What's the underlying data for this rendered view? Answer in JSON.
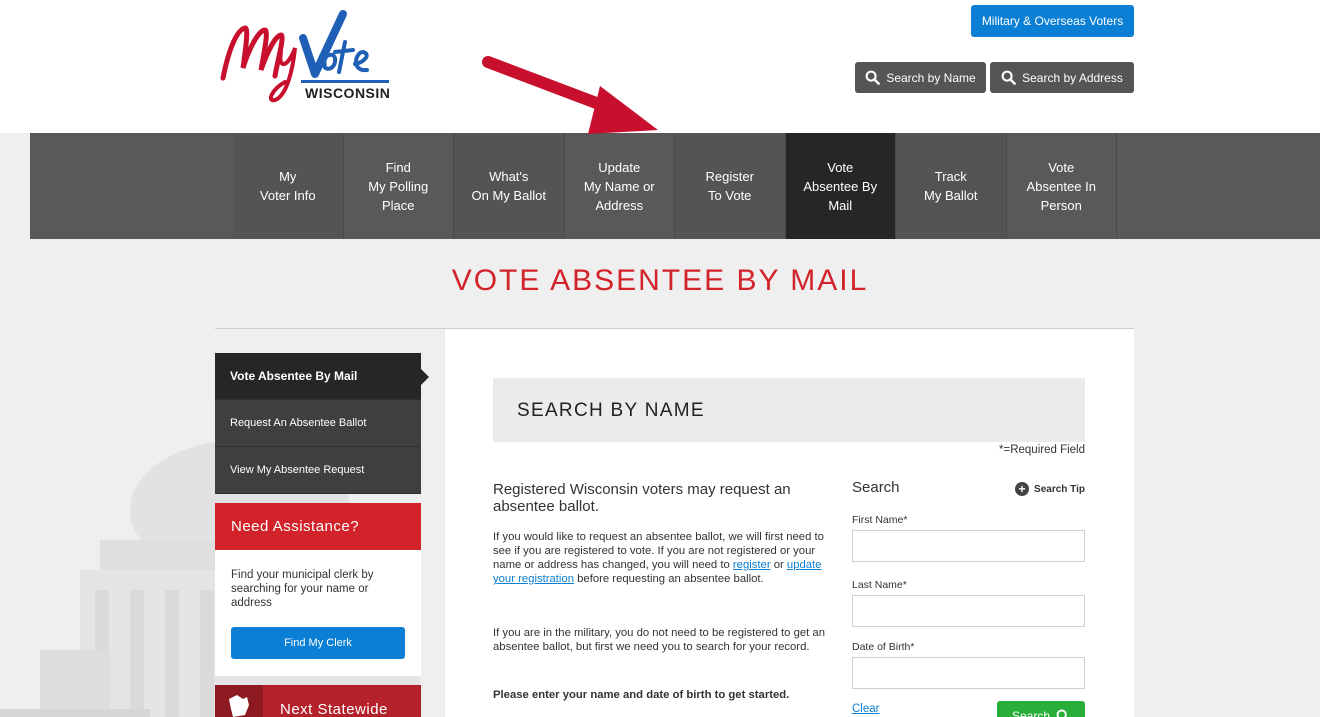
{
  "header": {
    "logo_text": "WISCONSIN",
    "military_button": "Military & Overseas Voters",
    "search_by_name": "Search by Name",
    "search_by_address": "Search by Address"
  },
  "nav": {
    "items": [
      {
        "label": "My\nVoter Info"
      },
      {
        "label": "Find\nMy Polling\nPlace"
      },
      {
        "label": "What's\nOn My Ballot"
      },
      {
        "label": "Update\nMy Name or\nAddress"
      },
      {
        "label": "Register\nTo Vote"
      },
      {
        "label": "Vote\nAbsentee By\nMail"
      },
      {
        "label": "Track\nMy Ballot"
      },
      {
        "label": "Vote\nAbsentee In\nPerson"
      }
    ]
  },
  "page_title": "VOTE ABSENTEE BY MAIL",
  "side_menu": {
    "items": [
      {
        "label": "Vote Absentee By Mail"
      },
      {
        "label": "Request An Absentee Ballot"
      },
      {
        "label": "View My Absentee Request"
      }
    ]
  },
  "assistance": {
    "title": "Need Assistance?",
    "body": "Find your municipal clerk by searching for your name or address",
    "button": "Find My Clerk"
  },
  "statewide": {
    "label": "Next Statewide"
  },
  "search_panel": {
    "heading": "SEARCH BY NAME",
    "required_note": "*=Required Field",
    "intro_heading": "Registered Wisconsin voters may request an absentee ballot.",
    "para1_a": "If you would like to request an absentee ballot, we will first need to see if you are registered to vote. If you are not registered or your name or address has changed, you will need to ",
    "para1_link1": "register",
    "para1_or": " or ",
    "para1_link2": "update your registration",
    "para1_b": " before requesting an absentee ballot.",
    "para2": "If you are in the military, you do not need to be registered to get an absentee ballot, but first we need you to search for your record.",
    "para3": "Please enter your name and date of birth to get started."
  },
  "form": {
    "title": "Search",
    "search_tip": "Search Tip",
    "first_name_label": "First Name*",
    "last_name_label": "Last Name*",
    "dob_label": "Date of Birth*",
    "clear": "Clear",
    "search_button": "Search"
  },
  "colors": {
    "brand_red": "#d2232a",
    "brand_blue": "#0b7fd3",
    "nav_gray": "#595959",
    "nav_active": "#262626",
    "search_green": "#2aae3a"
  }
}
